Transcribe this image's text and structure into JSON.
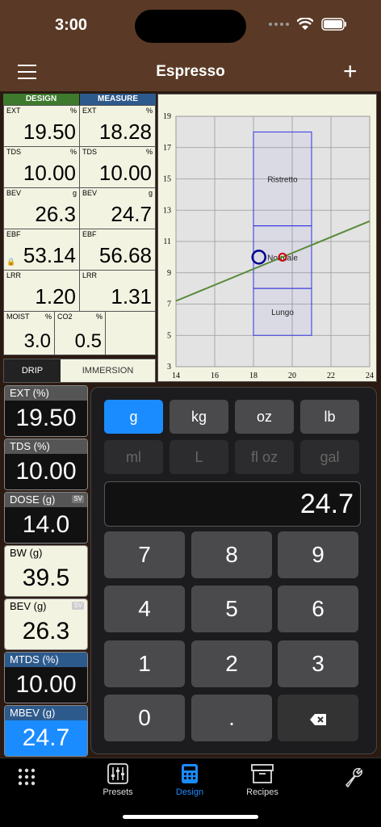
{
  "status": {
    "time": "3:00"
  },
  "nav": {
    "title": "Espresso"
  },
  "headers": {
    "design": "DESIGN",
    "measure": "MEASURE"
  },
  "cells": {
    "ext_d": {
      "label": "EXT",
      "unit": "%",
      "value": "19.50"
    },
    "ext_m": {
      "label": "EXT",
      "unit": "%",
      "value": "18.28"
    },
    "tds_d": {
      "label": "TDS",
      "unit": "%",
      "value": "10.00"
    },
    "tds_m": {
      "label": "TDS",
      "unit": "%",
      "value": "10.00"
    },
    "bev_d": {
      "label": "BEV",
      "unit": "g",
      "value": "26.3"
    },
    "bev_m": {
      "label": "BEV",
      "unit": "g",
      "value": "24.7"
    },
    "ebf_d": {
      "label": "EBF",
      "unit": "",
      "value": "53.14"
    },
    "ebf_m": {
      "label": "EBF",
      "unit": "",
      "value": "56.68"
    },
    "lrr_d": {
      "label": "LRR",
      "unit": "",
      "value": "1.20"
    },
    "lrr_m": {
      "label": "LRR",
      "unit": "",
      "value": "1.31"
    },
    "moist": {
      "label": "MOIST",
      "unit": "%",
      "value": "3.0"
    },
    "co2": {
      "label": "CO2",
      "unit": "%",
      "value": "0.5"
    }
  },
  "toggle": {
    "drip": "DRIP",
    "immersion": "IMMERSION"
  },
  "stats": [
    {
      "label": "EXT (%)",
      "value": "19.50"
    },
    {
      "label": "TDS (%)",
      "value": "10.00"
    },
    {
      "label": "DOSE (g)",
      "value": "14.0"
    },
    {
      "label": "BW (g)",
      "value": "39.5"
    },
    {
      "label": "BEV (g)",
      "value": "26.3"
    },
    {
      "label": "MTDS (%)",
      "value": "10.00"
    },
    {
      "label": "MBEV (g)",
      "value": "24.7"
    }
  ],
  "sv_tag": "SV",
  "units": [
    "g",
    "kg",
    "oz",
    "lb",
    "ml",
    "L",
    "fl oz",
    "gal"
  ],
  "display": "24.7",
  "keys": [
    "7",
    "8",
    "9",
    "4",
    "5",
    "6",
    "1",
    "2",
    "3",
    "0",
    "."
  ],
  "chart_data": {
    "type": "scatter",
    "xlim": [
      14,
      24
    ],
    "ylim": [
      3,
      19
    ],
    "x_ticks": [
      "14",
      "16",
      "18",
      "20",
      "22",
      "24"
    ],
    "y_ticks": [
      "3",
      "5",
      "7",
      "9",
      "11",
      "13",
      "15",
      "17",
      "19"
    ],
    "regions": [
      {
        "name": "Ristretto",
        "x": [
          18,
          21
        ],
        "y": [
          12,
          18
        ]
      },
      {
        "name": "Normale",
        "x": [
          18,
          21
        ],
        "y": [
          8,
          12
        ]
      },
      {
        "name": "Lungo",
        "x": [
          18,
          21
        ],
        "y": [
          5,
          8
        ]
      }
    ],
    "line": [
      {
        "x": 14,
        "y": 7.2
      },
      {
        "x": 24,
        "y": 12.3
      }
    ],
    "points": [
      {
        "x": 18.28,
        "y": 10.0,
        "color": "#00008b"
      },
      {
        "x": 19.5,
        "y": 10.0,
        "color": "#d00000"
      }
    ],
    "grid": true
  },
  "tabs": [
    {
      "label": "Presets"
    },
    {
      "label": "Design"
    },
    {
      "label": "Recipes"
    }
  ],
  "colors": {
    "brown": "#5a3a26",
    "accent": "#1a8cff",
    "header_green": "#3d7a2e",
    "header_blue": "#2d5a8c"
  }
}
